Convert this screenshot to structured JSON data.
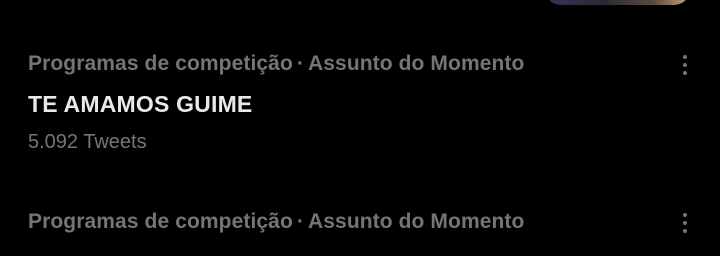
{
  "trends": [
    {
      "category": "Programas de competição",
      "separator": "·",
      "context": "Assunto do Momento",
      "title": "TE AMAMOS GUIME",
      "count": "5.092 Tweets",
      "more_icon": "more-vertical-icon"
    },
    {
      "category": "Programas de competição",
      "separator": "·",
      "context": "Assunto do Momento",
      "more_icon": "more-vertical-icon"
    }
  ],
  "colors": {
    "background": "#000000",
    "primary_text": "#e7e9ea",
    "secondary_text": "#71767b"
  }
}
